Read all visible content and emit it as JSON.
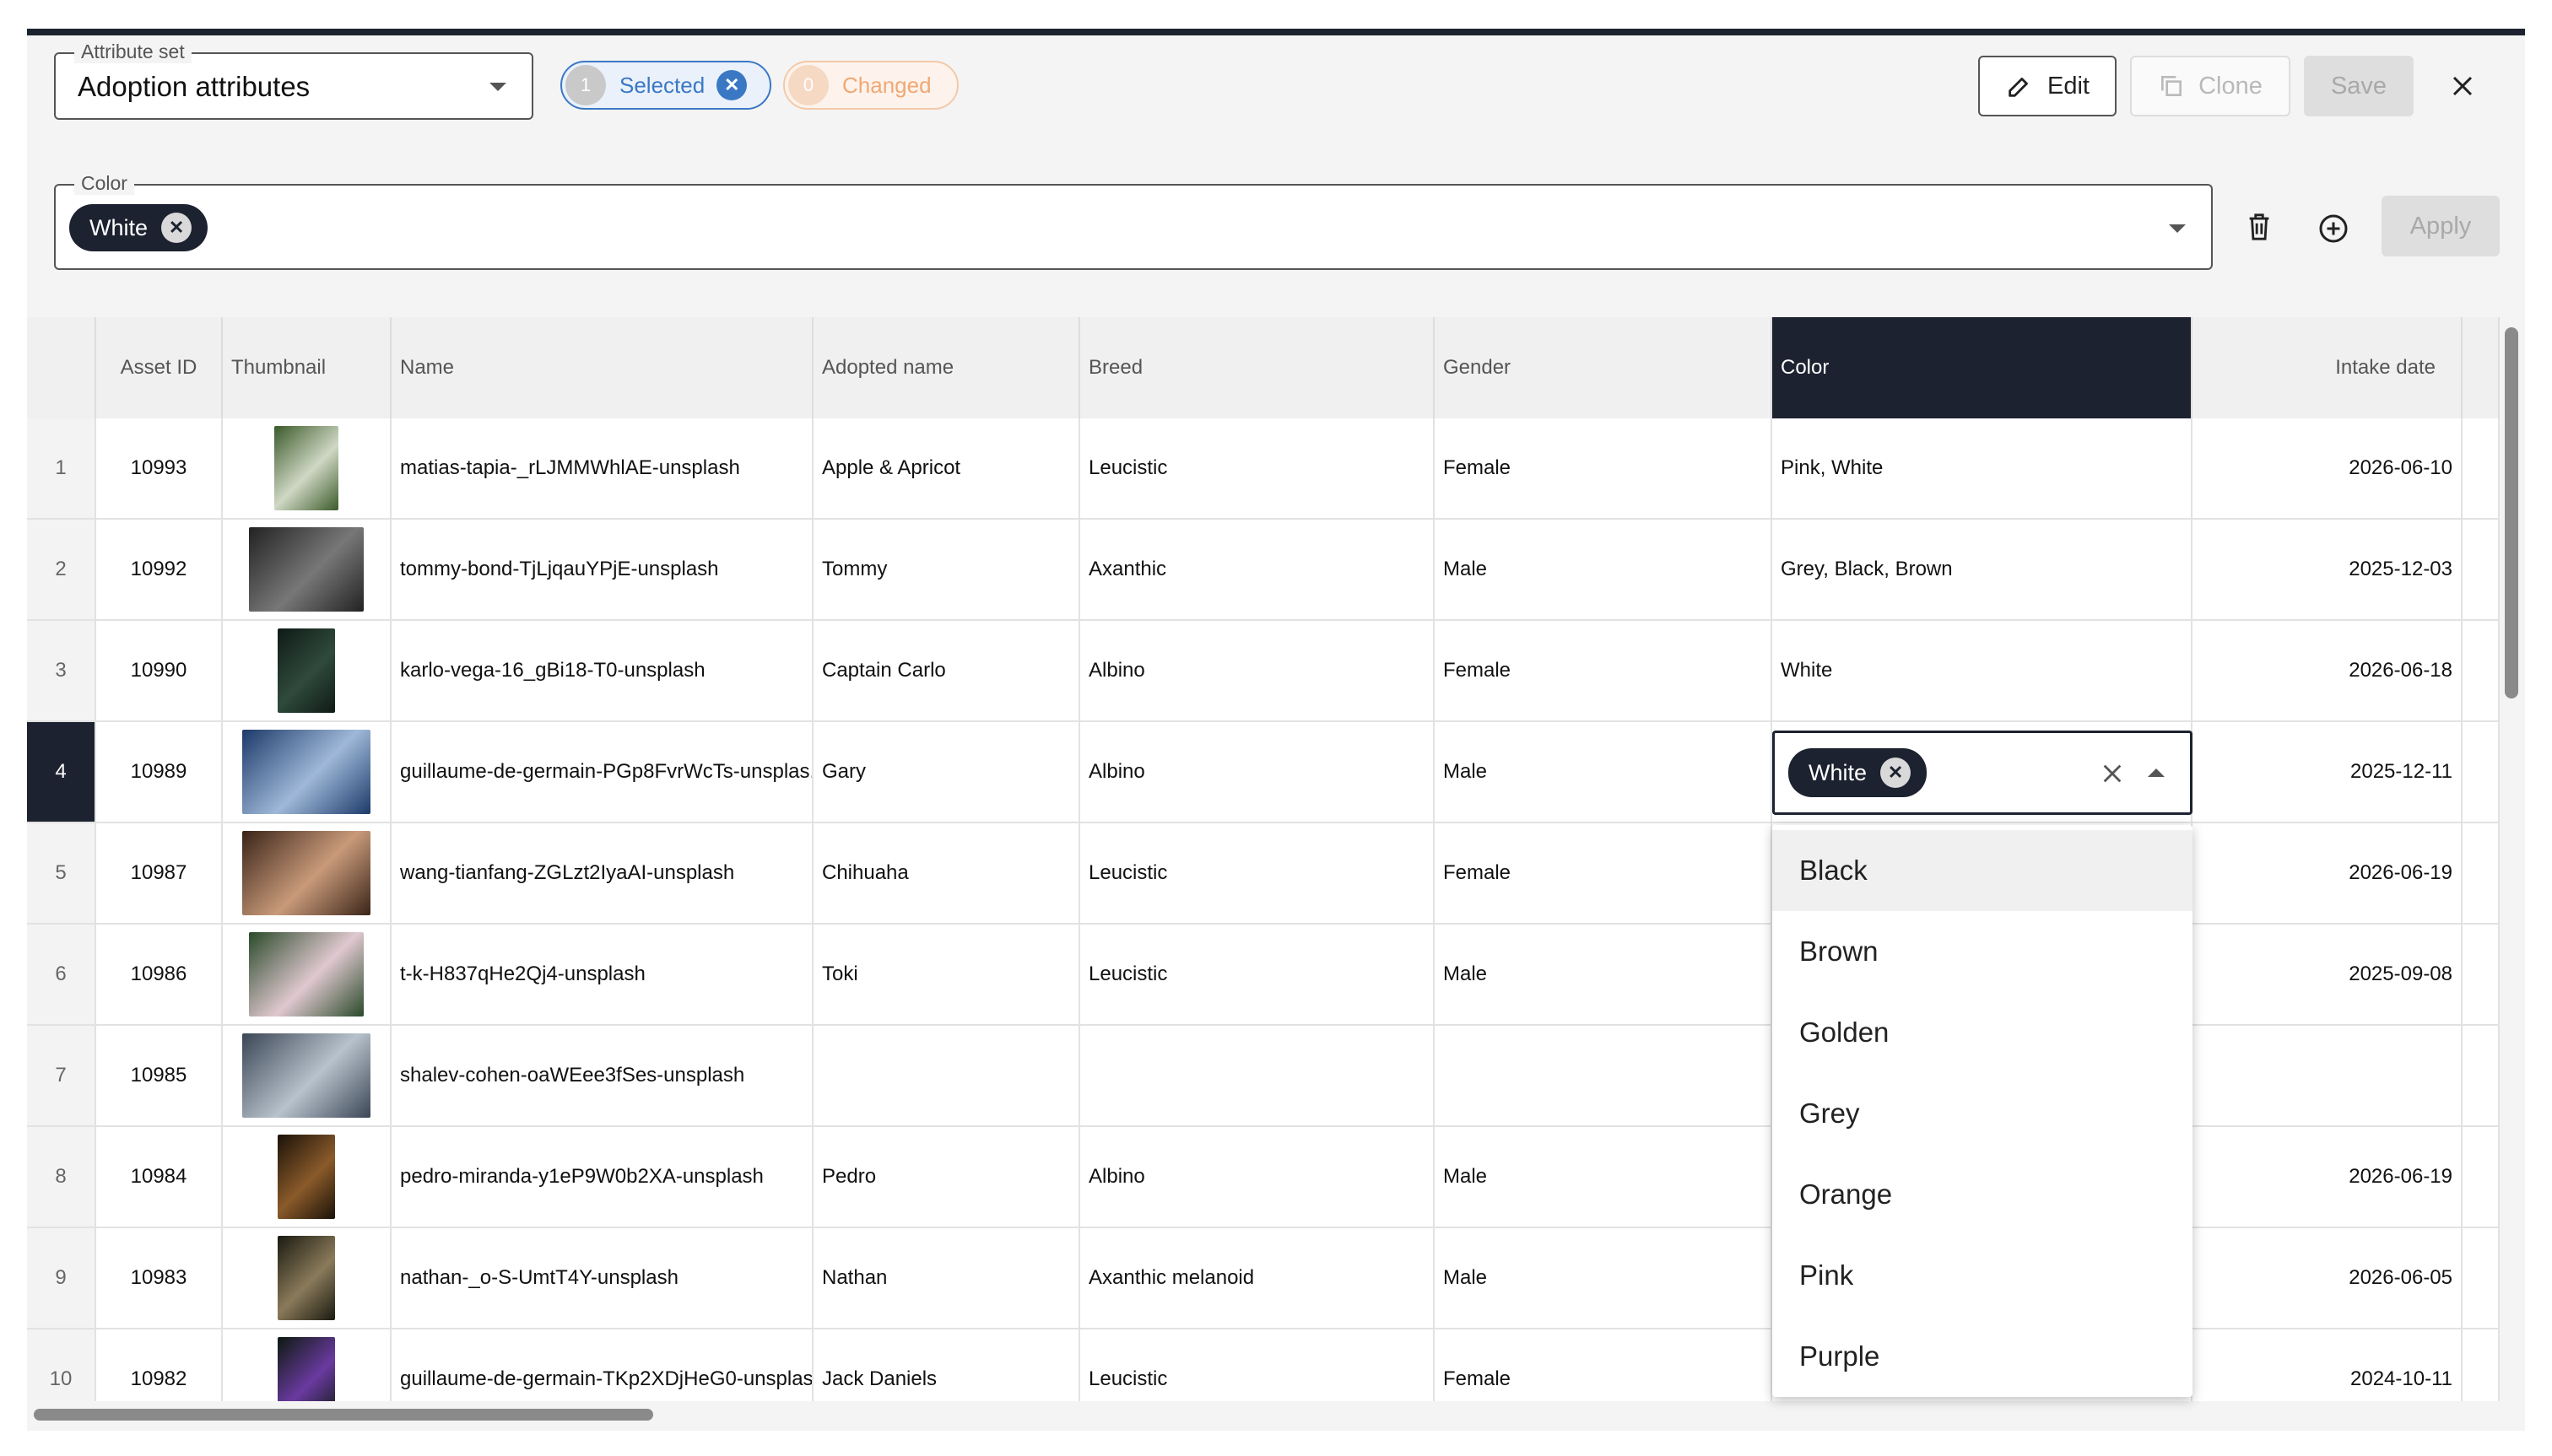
{
  "toolbar": {
    "attribute_set_label": "Attribute set",
    "attribute_set_value": "Adoption attributes",
    "selected_count": "1",
    "selected_label": "Selected",
    "changed_count": "0",
    "changed_label": "Changed",
    "edit_label": "Edit",
    "clone_label": "Clone",
    "save_label": "Save"
  },
  "filter": {
    "label": "Color",
    "chip": "White",
    "apply_label": "Apply"
  },
  "columns": [
    "Asset ID",
    "Thumbnail",
    "Name",
    "Adopted name",
    "Breed",
    "Gender",
    "Color",
    "Intake date"
  ],
  "rows": [
    {
      "n": "1",
      "id": "10993",
      "name": "matias-tapia-_rLJMMWhlAE-unsplash",
      "adopted": "Apple & Apricot",
      "breed": "Leucistic",
      "gender": "Female",
      "color": "Pink, White",
      "date": "2026-06-10"
    },
    {
      "n": "2",
      "id": "10992",
      "name": "tommy-bond-TjLjqauYPjE-unsplash",
      "adopted": "Tommy",
      "breed": "Axanthic",
      "gender": "Male",
      "color": "Grey, Black, Brown",
      "date": "2025-12-03"
    },
    {
      "n": "3",
      "id": "10990",
      "name": "karlo-vega-16_gBi18-T0-unsplash",
      "adopted": "Captain Carlo",
      "breed": "Albino",
      "gender": "Female",
      "color": "White",
      "date": "2026-06-18"
    },
    {
      "n": "4",
      "id": "10989",
      "name": "guillaume-de-germain-PGp8FvrWcTs-unsplas...",
      "adopted": "Gary",
      "breed": "Albino",
      "gender": "Male",
      "color": "",
      "date": "2025-12-11"
    },
    {
      "n": "5",
      "id": "10987",
      "name": "wang-tianfang-ZGLzt2IyaAI-unsplash",
      "adopted": "Chihuaha",
      "breed": "Leucistic",
      "gender": "Female",
      "color": "",
      "date": "2026-06-19"
    },
    {
      "n": "6",
      "id": "10986",
      "name": "t-k-H837qHe2Qj4-unsplash",
      "adopted": "Toki",
      "breed": "Leucistic",
      "gender": "Male",
      "color": "",
      "date": "2025-09-08"
    },
    {
      "n": "7",
      "id": "10985",
      "name": "shalev-cohen-oaWEee3fSes-unsplash",
      "adopted": "",
      "breed": "",
      "gender": "",
      "color": "",
      "date": ""
    },
    {
      "n": "8",
      "id": "10984",
      "name": "pedro-miranda-y1eP9W0b2XA-unsplash",
      "adopted": "Pedro",
      "breed": "Albino",
      "gender": "Male",
      "color": "",
      "date": "2026-06-19"
    },
    {
      "n": "9",
      "id": "10983",
      "name": "nathan-_o-S-UmtT4Y-unsplash",
      "adopted": "Nathan",
      "breed": "Axanthic melanoid",
      "gender": "Male",
      "color": "",
      "date": "2026-06-05"
    },
    {
      "n": "10",
      "id": "10982",
      "name": "guillaume-de-germain-TKp2XDjHeG0-unsplas...",
      "adopted": "Jack Daniels",
      "breed": "Leucistic",
      "gender": "Female",
      "color": "",
      "date": "2024-10-11"
    }
  ],
  "editor": {
    "chip": "White",
    "options": [
      "Black",
      "Brown",
      "Golden",
      "Grey",
      "Orange",
      "Pink",
      "Purple"
    ]
  },
  "colors": {
    "accent": "#1d2230",
    "selected_blue": "#3a78c4",
    "changed_orange": "#f0a874"
  }
}
